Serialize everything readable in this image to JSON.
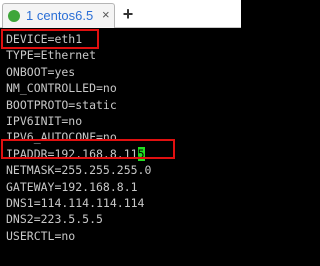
{
  "tab": {
    "number": "1",
    "title": "centos6.5",
    "close": "×",
    "add": "+"
  },
  "terminal": {
    "lines": [
      "DEVICE=eth1",
      "TYPE=Ethernet",
      "ONBOOT=yes",
      "NM_CONTROLLED=no",
      "BOOTPROTO=static",
      "IPV6INIT=no",
      "IPV6_AUTOCONF=no",
      "IPADDR=192.168.8.11",
      "NETMASK=255.255.255.0",
      "GATEWAY=192.168.8.1",
      "DNS1=114.114.114.114",
      "DNS2=223.5.5.5",
      "USERCTL=no"
    ],
    "cursor_char": "5"
  },
  "colors": {
    "terminal_bg": "#000000",
    "terminal_fg": "#c8c8c8",
    "cursor": "#22dd22",
    "highlight": "#e01010",
    "tab_accent": "#2b6fd6"
  }
}
